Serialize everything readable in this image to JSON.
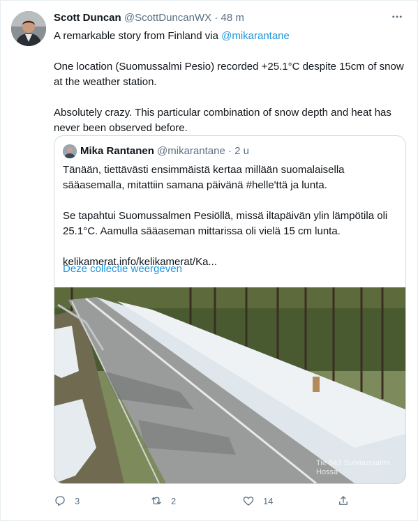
{
  "tweet": {
    "author_name": "Scott Duncan",
    "author_handle": "@ScottDuncanWX",
    "separator": "·",
    "time": "48 m",
    "more_icon": "more-dots-icon",
    "body": {
      "line1_prefix": "A remarkable story from Finland via ",
      "mention": "@mikarantane",
      "para2": "One location (Suomussalmi Pesio) recorded +25.1°C despite 15cm of snow at the weather station.",
      "para3": "Absolutely crazy. This particular combination of snow depth and heat has never been observed before."
    }
  },
  "quoted_tweet": {
    "author_name": "Mika Rantanen",
    "author_handle": "@mikarantane",
    "separator": "·",
    "time": "2 u",
    "para1": "Tänään, tiettävästi ensimmäistä kertaa millään suomalaisella sääasemalla, mitattiin samana päivänä #helle'ttä ja lunta.",
    "para2": "Se tapahtui Suomussalmen Pesiöllä, missä iltapäivän ylin lämpötila oli 25.1°C. Aamulla sääaseman mittarissa oli vielä 15 cm lunta.",
    "truncated_link": "kelikamerat.info/kelikamerat/Ka...",
    "show_collection": "Deze collectie weergeven",
    "image_watermark_line1": "Tie 843 Suomussalmi",
    "image_watermark_line2": "Hossa"
  },
  "actions": {
    "reply": {
      "icon": "reply-icon",
      "count": "3"
    },
    "retweet": {
      "icon": "retweet-icon",
      "count": "2"
    },
    "like": {
      "icon": "like-icon",
      "count": "14"
    },
    "share": {
      "icon": "share-icon"
    }
  },
  "colors": {
    "link": "#1b95e0",
    "muted": "#5b7083",
    "text": "#0f1419",
    "border": "#cfd9de"
  }
}
